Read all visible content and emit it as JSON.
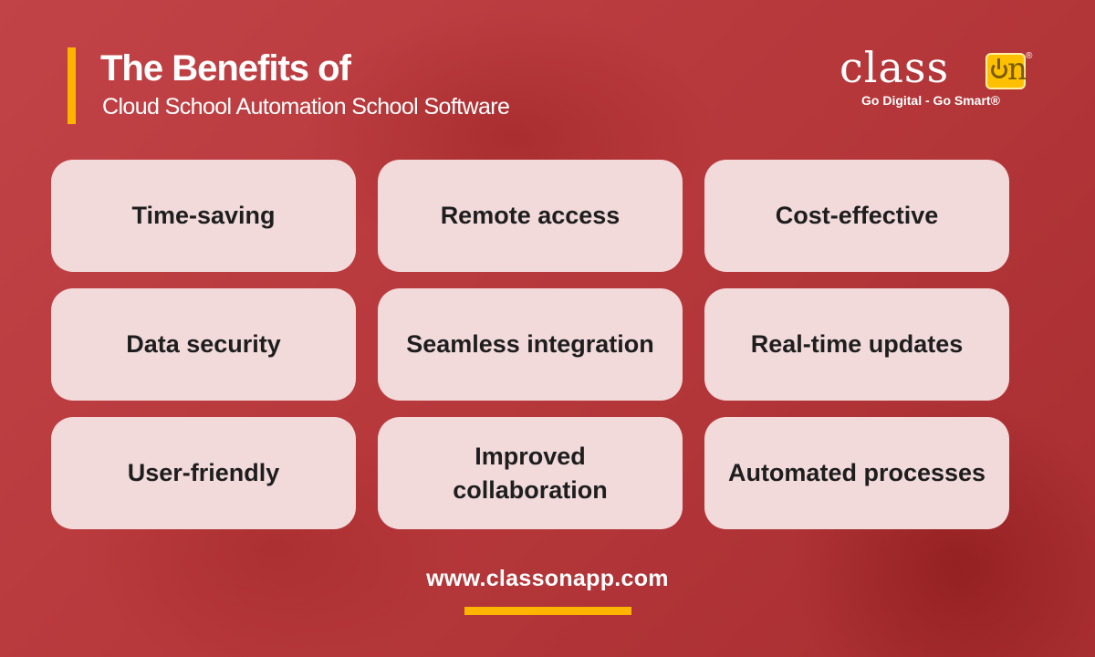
{
  "header": {
    "title": "The Benefits of",
    "subtitle": "Cloud School Automation School Software"
  },
  "logo": {
    "word": "class",
    "on_letter": "n",
    "registered": "®",
    "tagline": "Go Digital - Go Smart®",
    "accent_color": "#ffc000"
  },
  "benefits": [
    "Time-saving",
    "Remote access",
    "Cost-effective",
    "Data security",
    "Seamless integration",
    "Real-time updates",
    "User-friendly",
    "Improved collaboration",
    "Automated processes"
  ],
  "footer": {
    "url": "www.classonapp.com"
  },
  "colors": {
    "background": "#b8393c",
    "accent": "#ffb400",
    "card": "#f2dadb"
  }
}
